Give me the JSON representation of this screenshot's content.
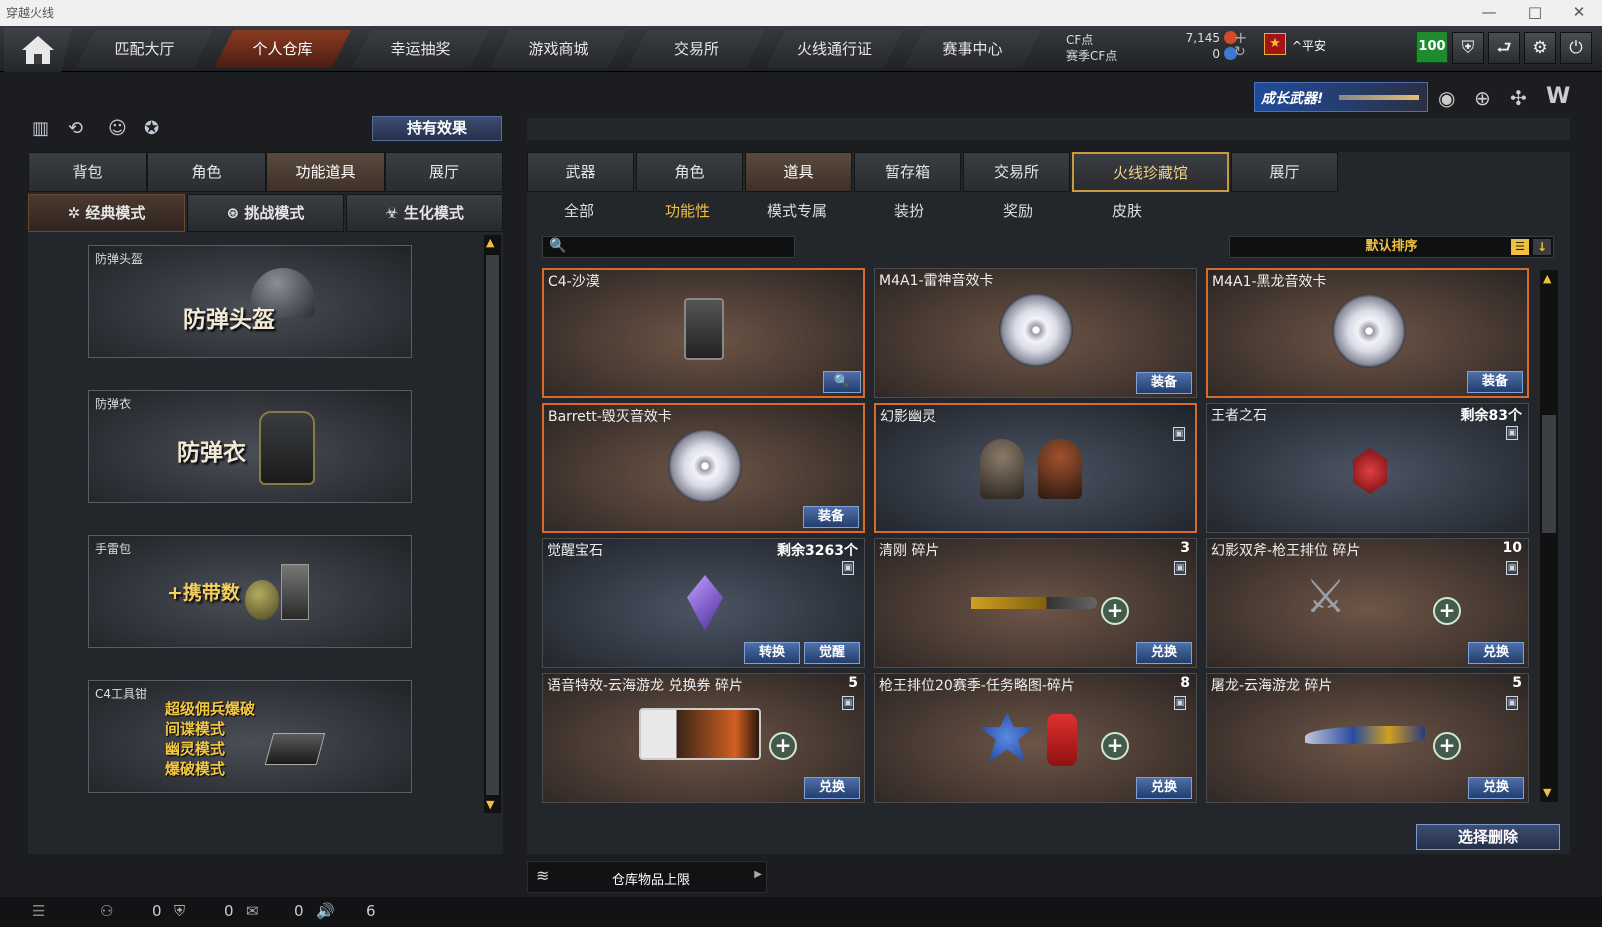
{
  "window": {
    "title": "穿越火线",
    "controls": [
      "—",
      "□",
      "✕"
    ]
  },
  "nav": {
    "tabs": [
      "匹配大厅",
      "个人仓库",
      "幸运抽奖",
      "游戏商城",
      "交易所",
      "火线通行证",
      "赛事中心"
    ],
    "active": 1
  },
  "currency": {
    "cf_label": "CF点",
    "cf_value": "7,145",
    "season_label": "赛季CF点",
    "season_value": "0"
  },
  "user": {
    "name": "^平安",
    "level": "100"
  },
  "banner": {
    "text": "成长武器!"
  },
  "left": {
    "hold_effect": "持有效果",
    "tabs": [
      "背包",
      "角色",
      "功能道具",
      "展厅"
    ],
    "active_tab": 2,
    "modes": [
      "经典模式",
      "挑战模式",
      "生化模式"
    ],
    "cards": [
      {
        "title": "防弹头盔",
        "big": "防弹头盔"
      },
      {
        "title": "防弹衣",
        "big": "防弹衣"
      },
      {
        "title": "手雷包",
        "big": "+携带数"
      },
      {
        "title": "C4工具钳",
        "lines": [
          "超级佣兵爆破",
          "间谍模式",
          "幽灵模式",
          "爆破模式"
        ]
      }
    ]
  },
  "right": {
    "tabs": [
      "武器",
      "角色",
      "道具",
      "暂存箱",
      "交易所",
      "火线珍藏馆",
      "展厅"
    ],
    "active_tab": 2,
    "subtabs": [
      "全部",
      "功能性",
      "模式专属",
      "装扮",
      "奖励",
      "皮肤"
    ],
    "active_sub": 1,
    "search": {
      "placeholder": ""
    },
    "sort": "默认排序",
    "items": [
      {
        "name": "C4-沙漠",
        "count": "",
        "btn": [
          "🔍"
        ]
      },
      {
        "name": "M4A1-雷神音效卡",
        "count": "",
        "btn": [
          "装备"
        ]
      },
      {
        "name": "M4A1-黑龙音效卡",
        "count": "",
        "btn": [
          "装备"
        ]
      },
      {
        "name": "Barrett-毁灭音效卡",
        "count": "",
        "btn": [
          "装备"
        ]
      },
      {
        "name": "幻影幽灵",
        "count": "",
        "btn": []
      },
      {
        "name": "王者之石",
        "count": "剩余83个",
        "btn": []
      },
      {
        "name": "觉醒宝石",
        "count": "剩余3263个",
        "btn": [
          "转换",
          "觉醒"
        ]
      },
      {
        "name": "清刚 碎片",
        "count": "3",
        "btn": [
          "兑换"
        ]
      },
      {
        "name": "幻影双斧-枪王排位 碎片",
        "count": "10",
        "btn": [
          "兑换"
        ]
      },
      {
        "name": "语音特效-云海游龙 兑换券 碎片",
        "count": "5",
        "btn": [
          "兑换"
        ]
      },
      {
        "name": "枪王排位20赛季-任务略图-碎片",
        "count": "8",
        "btn": [
          "兑换"
        ]
      },
      {
        "name": "屠龙-云海游龙 碎片",
        "count": "5",
        "btn": [
          "兑换"
        ]
      }
    ],
    "select_delete": "选择删除",
    "storage": "仓库物品上限"
  },
  "status": {
    "values": [
      "0",
      "0",
      "0",
      "6"
    ]
  },
  "colors": {
    "accent": "#d86a2c",
    "button_blue": "#2f5590",
    "gold": "#f0c040"
  }
}
